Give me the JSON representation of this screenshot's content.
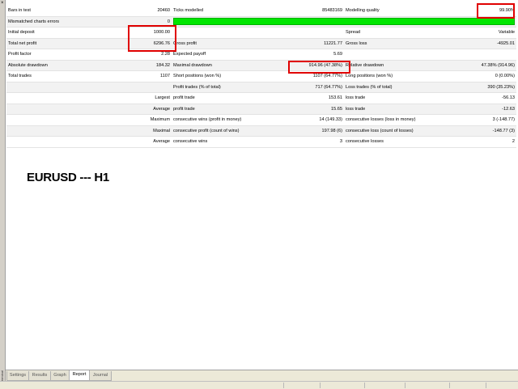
{
  "window": {
    "close_glyph": "×",
    "side_label": "Terminal"
  },
  "report": {
    "rows": [
      {
        "c1": "Bars in test",
        "c2": "20460",
        "c3": "Ticks modelled",
        "c4": "85483169",
        "c5": "Modelling quality",
        "c6": "99.90%"
      },
      {
        "c1": "Mismatched charts errors",
        "c2": "0",
        "c3": "",
        "c4": "",
        "c5": "",
        "c6": "",
        "quality_bar_fraction": 0.999
      },
      {
        "c1": "Initial deposit",
        "c2": "1000.00",
        "c3": "",
        "c4": "",
        "c5": "Spread",
        "c6": "Variable"
      },
      {
        "c1": "Total net profit",
        "c2": "6296.76",
        "c3": "Gross profit",
        "c4": "11221.77",
        "c5": "Gross loss",
        "c6": "-4925.01"
      },
      {
        "c1": "Profit factor",
        "c2": "2.28",
        "c3": "Expected payoff",
        "c4": "5.69",
        "c5": "",
        "c6": ""
      },
      {
        "c1": "Absolute drawdown",
        "c2": "184.32",
        "c3": "Maximal drawdown",
        "c4": "914.96 (47.38%)",
        "c5": "Relative drawdown",
        "c6": "47.38% (914.96)"
      },
      {
        "c1": "Total trades",
        "c2": "1107",
        "c3": "Short positions (won %)",
        "c4": "1107 (64.77%)",
        "c5": "Long positions (won %)",
        "c6": "0 (0.00%)"
      },
      {
        "c1": "",
        "c2": "",
        "c3": "Profit trades (% of total)",
        "c4": "717 (64.77%)",
        "c5": "Loss trades (% of total)",
        "c6": "390 (35.23%)"
      },
      {
        "c1": "",
        "c2": "Largest",
        "c3": "profit trade",
        "c4": "153.61",
        "c5": "loss trade",
        "c6": "-56.13"
      },
      {
        "c1": "",
        "c2": "Average",
        "c3": "profit trade",
        "c4": "15.65",
        "c5": "loss trade",
        "c6": "-12.63"
      },
      {
        "c1": "",
        "c2": "Maximum",
        "c3": "consecutive wins (profit in money)",
        "c4": "14 (149.33)",
        "c5": "consecutive losses (loss in money)",
        "c6": "3 (-148.77)"
      },
      {
        "c1": "",
        "c2": "Maximal",
        "c3": "consecutive profit (count of wins)",
        "c4": "197.98 (6)",
        "c5": "consecutive loss (count of losses)",
        "c6": "-148.77 (3)"
      },
      {
        "c1": "",
        "c2": "Average",
        "c3": "consecutive wins",
        "c4": "3",
        "c5": "consecutive losses",
        "c6": "2"
      }
    ]
  },
  "pair_title": "EURUSD --- H1",
  "tabs": [
    "Settings",
    "Results",
    "Graph",
    "Report",
    "Journal"
  ],
  "active_tab": "Report",
  "colors": {
    "quality_bar": "#00e600",
    "highlight": "#e00000"
  }
}
